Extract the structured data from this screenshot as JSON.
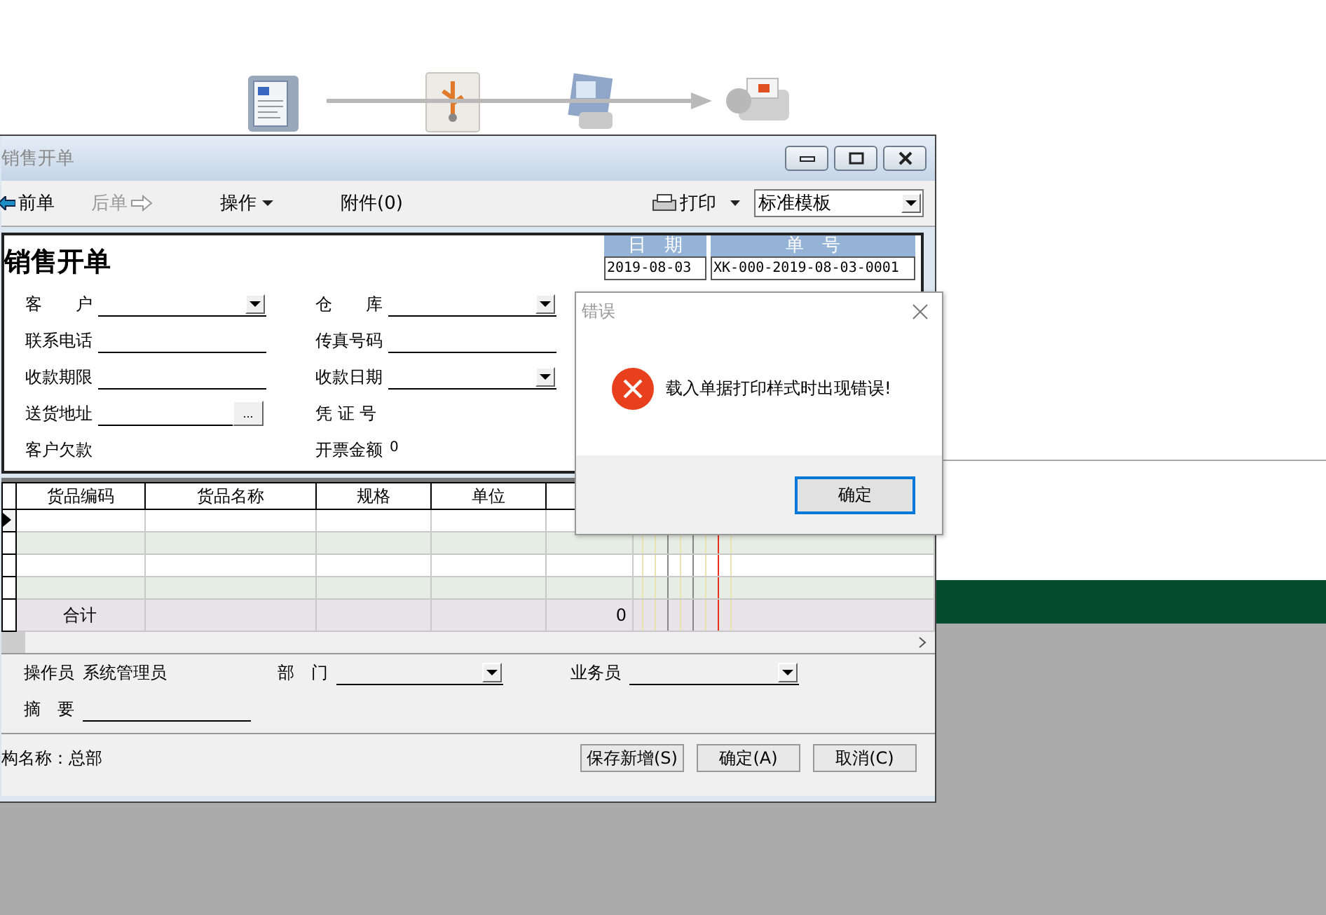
{
  "window": {
    "title": "销售开单"
  },
  "toolbar": {
    "items": [
      {
        "kind": "prev",
        "label": "前单",
        "disabled": false
      },
      {
        "kind": "next",
        "label": "后单",
        "disabled": true
      },
      {
        "kind": "menu",
        "label": "操作",
        "disabled": false
      },
      {
        "kind": "plain",
        "label": "附件(0)",
        "disabled": false
      }
    ],
    "print": {
      "label": "打印"
    },
    "template": {
      "value": "标准模板"
    }
  },
  "form": {
    "title": "销售开单",
    "date": {
      "label": "日　期",
      "value": "2019-08-03"
    },
    "number": {
      "label": "单　号",
      "value": "XK-000-2019-08-03-0001"
    },
    "fields": [
      {
        "label": "客　　户",
        "kind": "dropdown"
      },
      {
        "label": "仓　　库",
        "kind": "dropdown"
      },
      {
        "label": "联系电话",
        "kind": "line"
      },
      {
        "label": "传真号码",
        "kind": "line"
      },
      {
        "label": "收款期限",
        "kind": "line"
      },
      {
        "label": "收款日期",
        "kind": "dropdown"
      },
      {
        "label": "送货地址",
        "kind": "browse",
        "button": "..."
      },
      {
        "label": "凭 证 号",
        "kind": "text"
      },
      {
        "label": "客户欠款",
        "kind": "text"
      },
      {
        "label": "开票金额",
        "kind": "text",
        "value": "0"
      }
    ]
  },
  "table": {
    "columns": [
      "货品编码",
      "货品名称",
      "规格",
      "单位"
    ],
    "rows": [
      {
        "current": true
      },
      {
        "current": false
      },
      {
        "current": false
      },
      {
        "current": false
      }
    ],
    "total": {
      "label": "合计",
      "quantity": "0"
    }
  },
  "footer": {
    "operator": {
      "label": "操作员",
      "value": "系统管理员"
    },
    "department": {
      "label": "部　门"
    },
    "salesman": {
      "label": "业务员"
    },
    "summary": {
      "label": "摘　要"
    },
    "org": "构名称：总部",
    "buttons": [
      "保存新增(S)",
      "确定(A)",
      "取消(C)"
    ]
  },
  "dialog": {
    "title": "错误",
    "message": "载入单据打印样式时出现错误!",
    "button": "确定",
    "focused": true
  }
}
